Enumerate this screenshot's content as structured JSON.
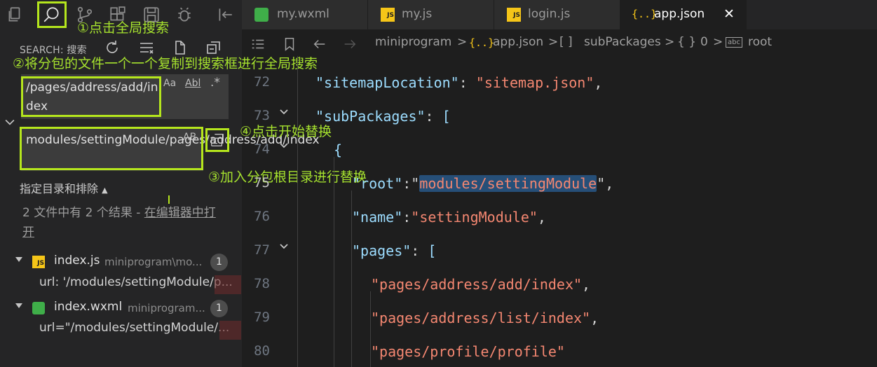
{
  "annotations": {
    "step1": "①点击全局搜索",
    "step2": "②将分包的文件一个一个复制到搜索框进行全局搜索",
    "step3": "③加入分包根目录进行替换",
    "step4": "④点击开始替换"
  },
  "sidebar": {
    "title": "SEARCH: 搜索",
    "search": {
      "value": "/pages/address/add/index",
      "opt_case": "Aa",
      "opt_word": "Abl",
      "opt_regex": ".*"
    },
    "replace": {
      "value": "modules/settingModule/pages/address/add/index",
      "opt_preserve_case": "AB"
    },
    "include_exclude_label": "指定目录和排除",
    "summary_text": "2 文件中有 2 个结果 - ",
    "summary_link": "在编辑器中打开",
    "results": [
      {
        "file": "index.js",
        "path": "miniprogram\\mo...",
        "count": "1",
        "icon": "js-icon",
        "match": "url: '/modules/settingModule/p..."
      },
      {
        "file": "index.wxml",
        "path": "miniprogram...",
        "count": "1",
        "icon": "wxml-icon",
        "match": "url=\"/modules/settingModule/..."
      }
    ]
  },
  "tabs": [
    {
      "label": "my.wxml",
      "icon": "wxml-icon"
    },
    {
      "label": "my.js",
      "icon": "js-icon"
    },
    {
      "label": "login.js",
      "icon": "js-icon"
    },
    {
      "label": "app.json",
      "icon": "json-icon",
      "active": true,
      "close": "✕"
    }
  ],
  "breadcrumbs": {
    "folder": "miniprogram",
    "file_icon": "{..}",
    "file": "app.json",
    "array_icon": "[ ]",
    "key": "subPackages",
    "obj_icon": "{ }",
    "index": "0",
    "leaf_icon": "abc",
    "leaf": "root",
    "sep": ">"
  },
  "code": {
    "lines": [
      {
        "num": "72",
        "key": "\"sitemapLocation\"",
        "colon": ": ",
        "val": "\"sitemap.json\"",
        "tail": ","
      },
      {
        "num": "73",
        "key": "\"subPackages\"",
        "colon": ": ",
        "tail": "["
      },
      {
        "num": "74",
        "tail": "{"
      },
      {
        "num": "75",
        "key": "\"root\"",
        "colon": ":\"",
        "val": "modules/settingModule",
        "tail": "\","
      },
      {
        "num": "76",
        "key": "\"name\"",
        "colon": ":",
        "val": "\"settingModule\"",
        "tail": ","
      },
      {
        "num": "77",
        "key": "\"pages\"",
        "colon": ": ",
        "tail": "["
      },
      {
        "num": "78",
        "val": "\"pages/address/add/index\"",
        "tail": ","
      },
      {
        "num": "79",
        "val": "\"pages/address/list/index\"",
        "tail": ","
      },
      {
        "num": "80",
        "val": "\"pages/profile/profile\""
      }
    ]
  },
  "colors": {
    "accent_annotation": "#b5e61d",
    "json_key": "#9cdcfe",
    "json_string": "#f48771",
    "selection": "#264f78"
  }
}
